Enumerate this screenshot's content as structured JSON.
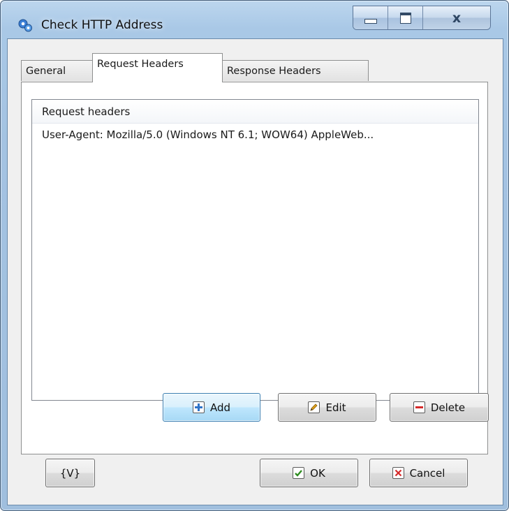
{
  "window": {
    "title": "Check HTTP Address",
    "close_glyph": "x"
  },
  "tabs": [
    {
      "label": "General"
    },
    {
      "label": "Request Headers"
    },
    {
      "label": "Response Headers"
    }
  ],
  "list": {
    "header": "Request headers",
    "rows": [
      "User-Agent: Mozilla/5.0 (Windows NT 6.1; WOW64) AppleWeb..."
    ]
  },
  "buttons": {
    "add": "Add",
    "edit": "Edit",
    "delete": "Delete",
    "variables": "{V}",
    "ok": "OK",
    "cancel": "Cancel"
  },
  "icons": {
    "app": "gears-icon",
    "add": "plus-icon",
    "edit": "pencil-icon",
    "delete": "minus-icon",
    "ok": "checkmark-icon",
    "cancel": "x-icon"
  },
  "colors": {
    "titlebar": "#a4c3e2",
    "add_icon": "#2f74c8",
    "edit_icon": "#e0a21c",
    "delete_icon": "#d52a2a",
    "ok_icon": "#2d8c1f",
    "cancel_icon": "#d52a2a"
  }
}
